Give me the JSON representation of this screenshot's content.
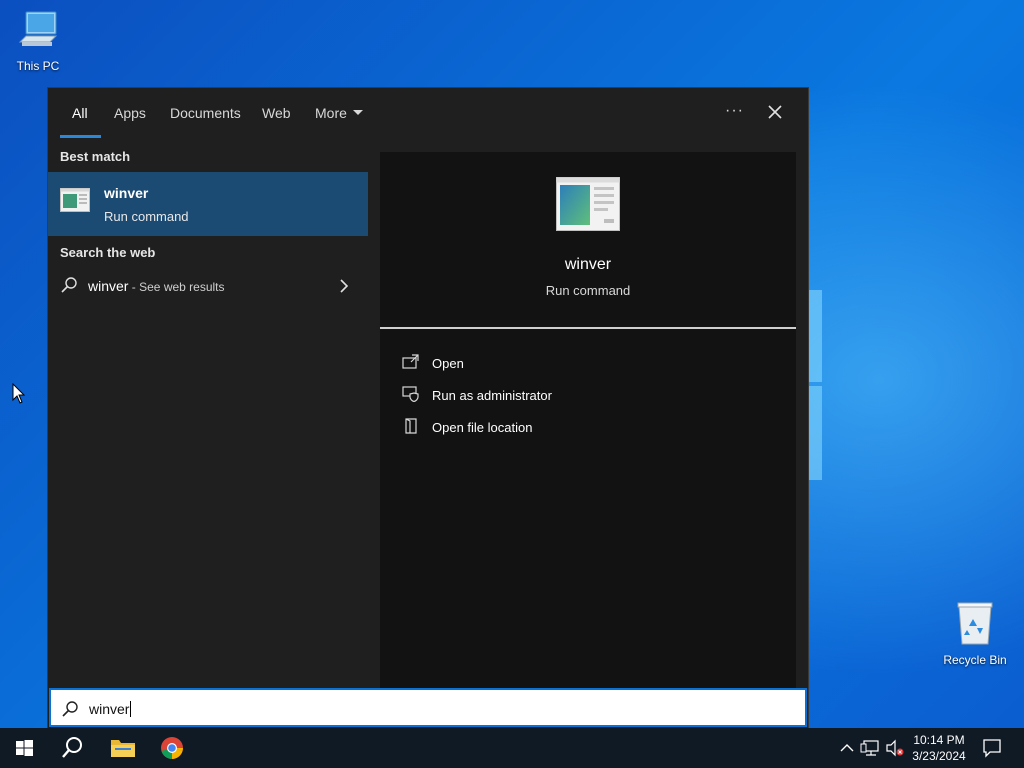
{
  "desktop": {
    "icons": [
      {
        "label": "This PC",
        "icon": "this-pc-icon"
      },
      {
        "label": "Recycle Bin",
        "icon": "recycle-bin-icon"
      }
    ]
  },
  "search": {
    "tabs": [
      {
        "label": "All",
        "active": true
      },
      {
        "label": "Apps",
        "active": false
      },
      {
        "label": "Documents",
        "active": false
      },
      {
        "label": "Web",
        "active": false
      },
      {
        "label": "More",
        "active": false
      }
    ],
    "overflow_label": "···",
    "best_match": {
      "section": "Best match",
      "name": "winver",
      "type": "Run command"
    },
    "search_web": {
      "section": "Search the web",
      "query": "winver",
      "suffix": " - See web results"
    },
    "preview": {
      "name": "winver",
      "type": "Run command",
      "actions": [
        {
          "label": "Open",
          "icon": "open-icon"
        },
        {
          "label": "Run as administrator",
          "icon": "run-as-admin-icon"
        },
        {
          "label": "Open file location",
          "icon": "file-location-icon"
        }
      ]
    },
    "input_value": "winver"
  },
  "taskbar": {
    "pinned": [
      "start-icon",
      "search-icon",
      "file-explorer-icon",
      "chrome-icon"
    ],
    "tray": [
      "show-hidden-icons",
      "network-icon",
      "volume-muted-icon"
    ],
    "time": "10:14 PM",
    "date": "3/23/2024",
    "notifications": "action-center-icon"
  },
  "colors": {
    "panel_bg": "#1f1f1f",
    "preview_bg": "#121212",
    "selected_bg": "#1b4a73",
    "accent": "#2b88d8",
    "taskbar_bg": "#101a25"
  }
}
